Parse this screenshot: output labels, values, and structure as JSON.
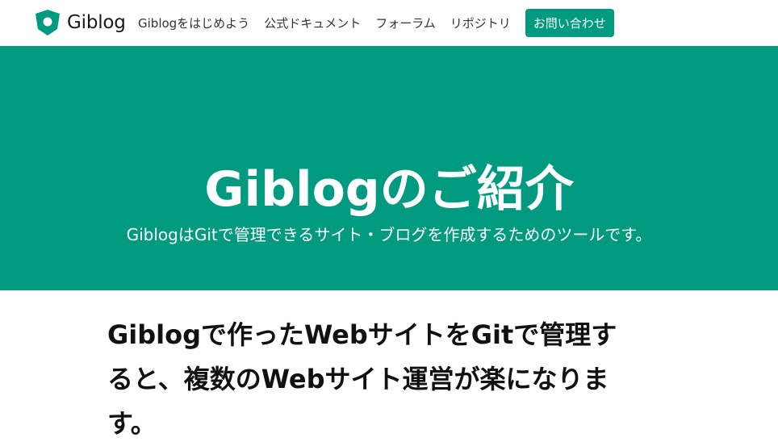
{
  "header": {
    "logo_text": "Giblog",
    "nav": [
      {
        "label": "Giblogをはじめよう"
      },
      {
        "label": "公式ドキュメント"
      },
      {
        "label": "フォーラム"
      },
      {
        "label": "リポジトリ"
      }
    ],
    "contact_button": "お問い合わせ"
  },
  "hero": {
    "title": "Giblogのご紹介",
    "subtitle": "GiblogはGitで管理できるサイト・ブログを作成するためのツールです。"
  },
  "main": {
    "lead": "Giblogで作ったWebサイトをGitで管理すると、複数のWebサイト運営が楽になります。"
  },
  "colors": {
    "brand": "#009a80",
    "text": "#111111",
    "nav_text": "#333333",
    "background": "#ffffff"
  },
  "icons": {
    "logo": "giblog-logo-icon"
  }
}
